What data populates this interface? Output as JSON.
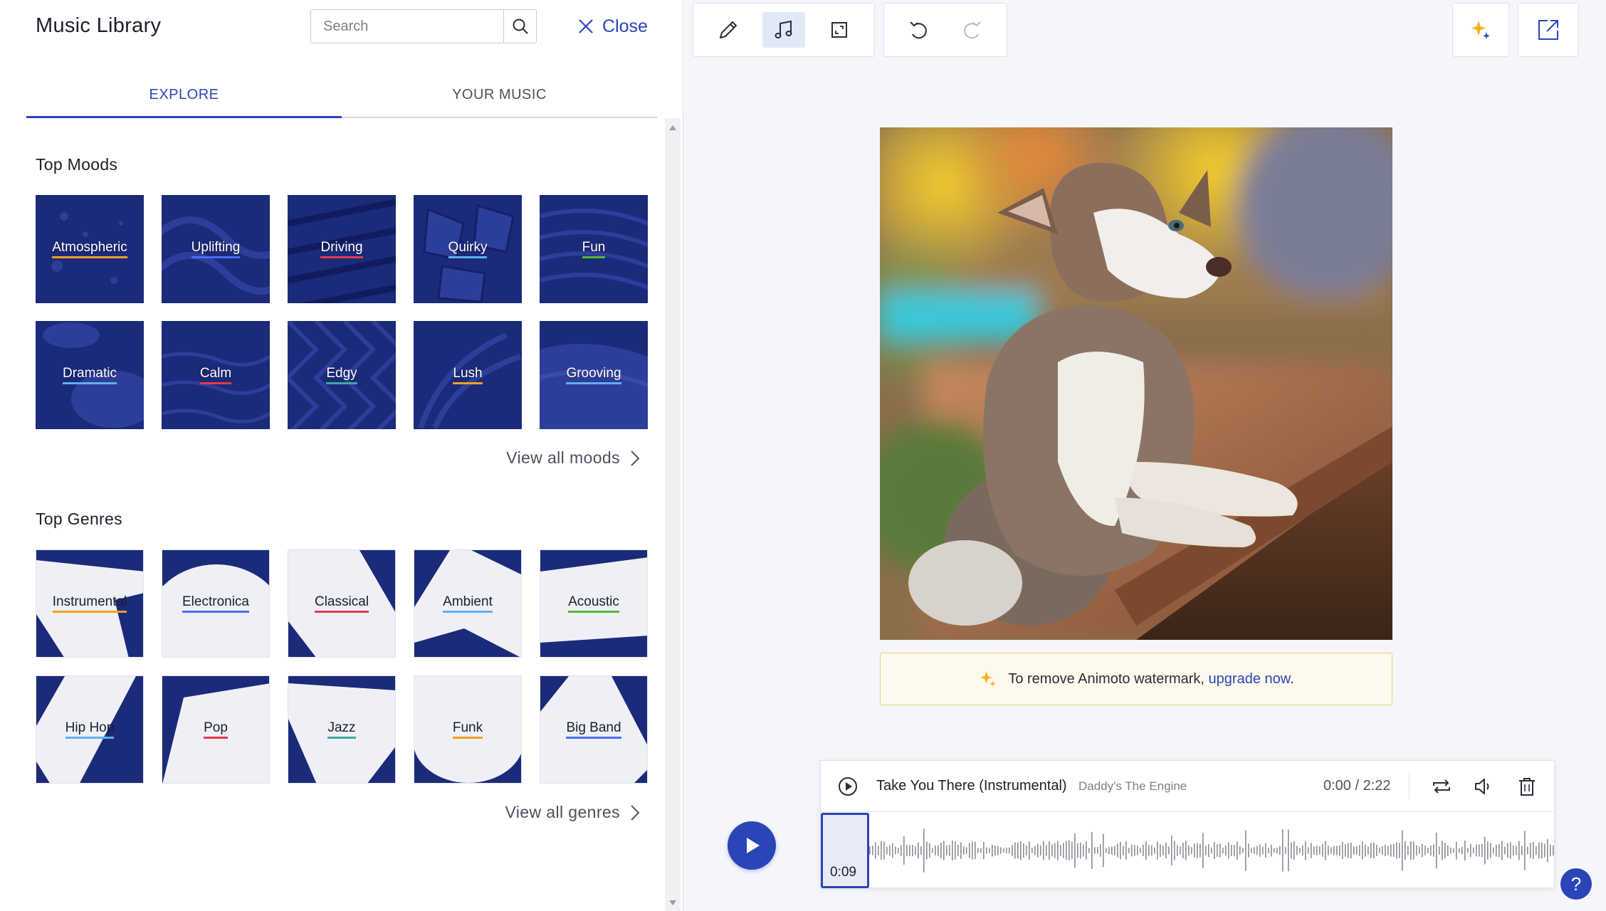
{
  "library": {
    "title": "Music Library",
    "search_placeholder": "Search",
    "close_label": "Close",
    "tabs": [
      {
        "label": "EXPLORE",
        "active": true
      },
      {
        "label": "YOUR MUSIC",
        "active": false
      }
    ],
    "moods_title": "Top Moods",
    "moods": [
      {
        "label": "Atmospheric",
        "underline": "#f0a020"
      },
      {
        "label": "Uplifting",
        "underline": "#4a6ef0"
      },
      {
        "label": "Driving",
        "underline": "#e8384a"
      },
      {
        "label": "Quirky",
        "underline": "#60b0f0"
      },
      {
        "label": "Fun",
        "underline": "#58b838"
      },
      {
        "label": "Dramatic",
        "underline": "#60b0f0"
      },
      {
        "label": "Calm",
        "underline": "#e8384a"
      },
      {
        "label": "Edgy",
        "underline": "#40a8a0"
      },
      {
        "label": "Lush",
        "underline": "#f0a020"
      },
      {
        "label": "Grooving",
        "underline": "#60b0f0"
      }
    ],
    "view_all_moods": "View all moods",
    "genres_title": "Top Genres",
    "genres": [
      {
        "label": "Instrumental",
        "underline": "#f0a020"
      },
      {
        "label": "Electronica",
        "underline": "#4a6ef0"
      },
      {
        "label": "Classical",
        "underline": "#e8384a"
      },
      {
        "label": "Ambient",
        "underline": "#60b0f0"
      },
      {
        "label": "Acoustic",
        "underline": "#58b838"
      },
      {
        "label": "Hip Hop",
        "underline": "#60b0f0"
      },
      {
        "label": "Pop",
        "underline": "#e8384a"
      },
      {
        "label": "Jazz",
        "underline": "#40a8a0"
      },
      {
        "label": "Funk",
        "underline": "#f0a020"
      },
      {
        "label": "Big Band",
        "underline": "#4a6ef0"
      }
    ],
    "view_all_genres": "View all genres"
  },
  "toolbar": {
    "tools": [
      "pencil-icon",
      "music-note-icon",
      "resize-icon"
    ],
    "active_tool": "music-note-icon",
    "history": [
      "undo-icon",
      "redo-icon"
    ]
  },
  "watermark": {
    "text": "To remove Animoto watermark,",
    "link": "upgrade now",
    "suffix": "."
  },
  "track": {
    "title": "Take You There (Instrumental)",
    "artist": "Daddy's The Engine",
    "time": "0:00 / 2:22",
    "handle_time": "0:09"
  },
  "help_label": "?",
  "colors": {
    "accent": "#2a45b6",
    "tile_navy": "#1c2a7a",
    "watermark_bg": "#fdf9ec"
  }
}
